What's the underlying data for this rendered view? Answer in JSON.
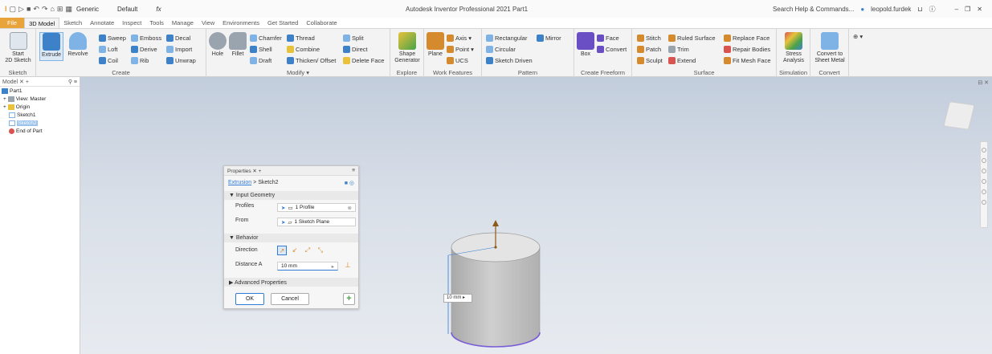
{
  "app": {
    "title": "Autodesk Inventor Professional 2021  Part1"
  },
  "quick_access": {
    "appearance": "Generic",
    "material": "Default",
    "fx": "fx"
  },
  "search": {
    "text": "Search Help & Commands..."
  },
  "user": {
    "name": "leopold.furdek"
  },
  "tabs": [
    {
      "label": "File"
    },
    {
      "label": "3D Model"
    },
    {
      "label": "Sketch"
    },
    {
      "label": "Annotate"
    },
    {
      "label": "Inspect"
    },
    {
      "label": "Tools"
    },
    {
      "label": "Manage"
    },
    {
      "label": "View"
    },
    {
      "label": "Environments"
    },
    {
      "label": "Get Started"
    },
    {
      "label": "Collaborate"
    }
  ],
  "ribbon": {
    "sketch": {
      "start": "Start\n2D Sketch",
      "panel": "Sketch"
    },
    "create": {
      "extrude": "Extrude",
      "revolve": "Revolve",
      "sweep": "Sweep",
      "emboss": "Emboss",
      "decal": "Decal",
      "loft": "Loft",
      "derive": "Derive",
      "import": "Import",
      "coil": "Coil",
      "rib": "Rib",
      "unwrap": "Unwrap",
      "panel": "Create"
    },
    "modify": {
      "hole": "Hole",
      "fillet": "Fillet",
      "chamfer": "Chamfer",
      "thread": "Thread",
      "split": "Split",
      "shell": "Shell",
      "combine": "Combine",
      "direct": "Direct",
      "draft": "Draft",
      "thicken": "Thicken/ Offset",
      "delete_face": "Delete Face",
      "panel": "Modify ▾"
    },
    "explore": {
      "shape_gen": "Shape\nGenerator",
      "panel": "Explore"
    },
    "work": {
      "plane": "Plane",
      "axis": "Axis ▾",
      "point": "Point ▾",
      "ucs": "UCS",
      "panel": "Work Features"
    },
    "pattern": {
      "rectangular": "Rectangular",
      "mirror": "Mirror",
      "circular": "Circular",
      "sketch_driven": "Sketch Driven",
      "panel": "Pattern"
    },
    "freeform": {
      "box": "Box",
      "face": "Face",
      "convert": "Convert",
      "panel": "Create Freeform"
    },
    "surface": {
      "stitch": "Stitch",
      "ruled": "Ruled Surface",
      "replace": "Replace Face",
      "patch": "Patch",
      "trim": "Trim",
      "repair": "Repair Bodies",
      "sculpt": "Sculpt",
      "extend": "Extend",
      "fit_mesh": "Fit Mesh Face",
      "panel": "Surface"
    },
    "simulation": {
      "stress": "Stress\nAnalysis",
      "panel": "Simulation"
    },
    "convert": {
      "sheet": "Convert to\nSheet Metal",
      "panel": "Convert"
    }
  },
  "browser": {
    "tab": "Model",
    "items": [
      {
        "label": "Part1"
      },
      {
        "label": "View: Master"
      },
      {
        "label": "Origin"
      },
      {
        "label": "Sketch1"
      },
      {
        "label": "Sketch2"
      },
      {
        "label": "End of Part"
      }
    ]
  },
  "properties": {
    "tab": "Properties",
    "crumb_op": "Extrusion",
    "crumb_sep": ">",
    "crumb_target": "Sketch2",
    "input_geometry": "▼ Input Geometry",
    "profiles_label": "Profiles",
    "profiles_value": "1 Profile",
    "from_label": "From",
    "from_value": "1 Sketch Plane",
    "behavior": "▼ Behavior",
    "direction_label": "Direction",
    "distance_label": "Distance A",
    "distance_value": "10 mm",
    "advanced": "▶ Advanced Properties",
    "ok": "OK",
    "cancel": "Cancel"
  },
  "viewport": {
    "dim_label": "10 mm"
  },
  "colors": {
    "accent": "#e8a33a",
    "selection": "#7a5cd6",
    "arrow": "#8a5a1a"
  }
}
